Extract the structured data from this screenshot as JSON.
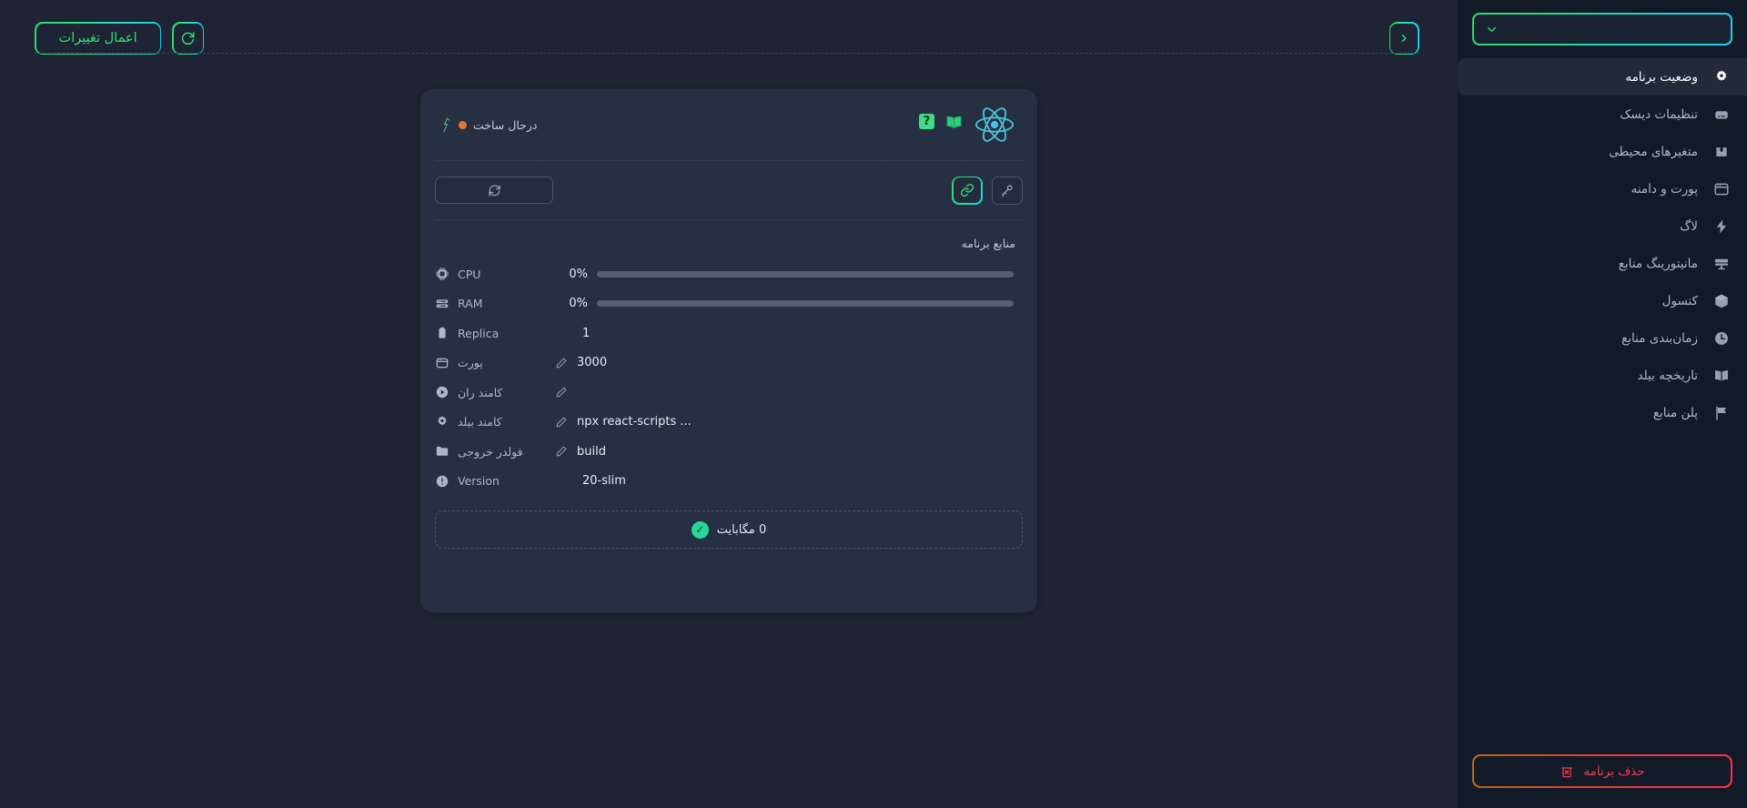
{
  "toolbar": {
    "apply_label": "اعمال تغییرات",
    "refresh_icon": "refresh-icon",
    "next_icon": "chevron-right-icon"
  },
  "card": {
    "status_text": "درحال ساخت",
    "status_color": "#e8772e",
    "framework_icon": "react-logo-icon",
    "docs_icon": "open-book-icon",
    "help_icon": "question-mark-icon",
    "select_placeholder": "",
    "select_icon": "refresh-icon",
    "key_icon": "key-icon",
    "link_icon": "link-icon",
    "resources_title": "منابع برنامه",
    "rows": [
      {
        "icon": "cpu-icon",
        "label": "CPU",
        "kind": "bar",
        "value": "0%",
        "percent": 0,
        "editable": false
      },
      {
        "icon": "ram-icon",
        "label": "RAM",
        "kind": "bar",
        "value": "0%",
        "percent": 0,
        "editable": false
      },
      {
        "icon": "replica-icon",
        "label": "Replica",
        "kind": "plain",
        "value": "1",
        "editable": false
      },
      {
        "icon": "port-icon",
        "label": "پورت",
        "kind": "text",
        "value": "3000",
        "editable": true
      },
      {
        "icon": "play-icon",
        "label": "کامند ران",
        "kind": "text",
        "value": "",
        "editable": true
      },
      {
        "icon": "gear-icon",
        "label": "کامند بیلد",
        "kind": "text",
        "value": "npx react-scripts ...",
        "editable": true
      },
      {
        "icon": "folder-icon",
        "label": "فولدر خروجی",
        "kind": "text",
        "value": "build",
        "editable": true
      },
      {
        "icon": "info-icon",
        "label": "Version",
        "kind": "plain",
        "value": "20-slim",
        "editable": false
      }
    ],
    "storage_text": "0 مگابایت",
    "storage_status_icon": "check-circle-icon"
  },
  "sidebar": {
    "select_value": "",
    "select_icon": "chevron-down-icon",
    "items": [
      {
        "label": "وضعیت برنامه",
        "icon": "gear-icon",
        "active": true
      },
      {
        "label": "تنظیمات دیسک",
        "icon": "disk-icon",
        "active": false
      },
      {
        "label": "متغیرهای محیطی",
        "icon": "env-icon",
        "active": false
      },
      {
        "label": "پورت و دامنه",
        "icon": "browser-icon",
        "active": false
      },
      {
        "label": "لاگ",
        "icon": "bolt-icon",
        "active": false
      },
      {
        "label": "مانیتورینگ منابع",
        "icon": "monitor-icon",
        "active": false
      },
      {
        "label": "کنسول",
        "icon": "cube-icon",
        "active": false
      },
      {
        "label": "زمان‌بندی منابع",
        "icon": "clock-icon",
        "active": false
      },
      {
        "label": "تاریخچه بیلد",
        "icon": "book-icon",
        "active": false
      },
      {
        "label": "پلن منابع",
        "icon": "flag-icon",
        "active": false
      }
    ],
    "delete_label": "حذف برنامه",
    "delete_icon": "trash-icon",
    "delete_color": "#f43b4e"
  }
}
